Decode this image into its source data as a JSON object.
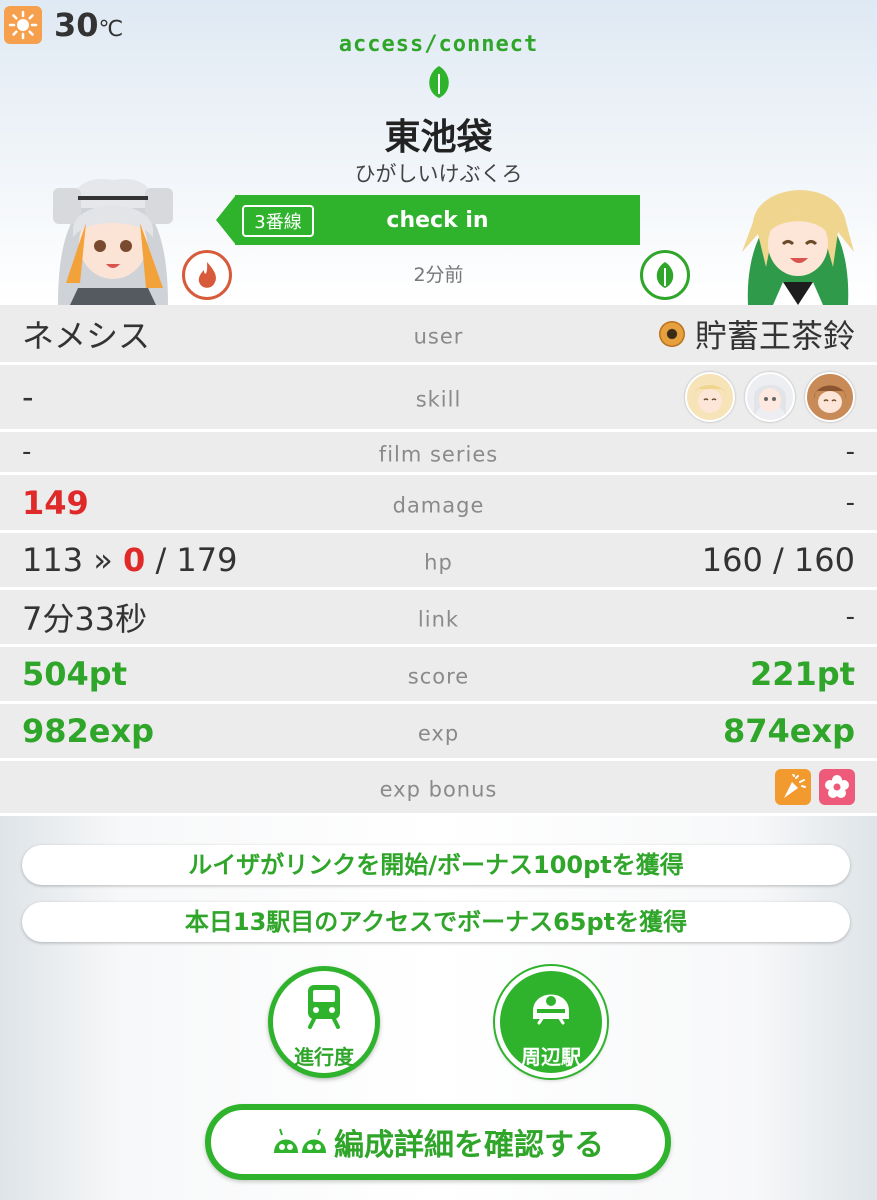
{
  "weather": {
    "icon": "sun-icon",
    "temp": "30",
    "unit": "℃"
  },
  "header": {
    "status": "access/connect",
    "station_name": "東池袋",
    "station_kana": "ひがしいけぶくろ",
    "line_label": "3番線",
    "action": "check in",
    "time_ago": "2分前"
  },
  "table": {
    "user": {
      "label": "user",
      "left": "ネメシス",
      "right": "貯蓄王茶鈴"
    },
    "skill": {
      "label": "skill",
      "left": "-"
    },
    "film_series": {
      "label": "film series",
      "left": "-",
      "right": "-"
    },
    "damage": {
      "label": "damage",
      "left": "149",
      "right": "-"
    },
    "hp": {
      "label": "hp",
      "left_before": "113 »",
      "left_now": "0",
      "left_max": "/ 179",
      "right": "160 / 160"
    },
    "link": {
      "label": "link",
      "left": "7分33秒",
      "right": "-"
    },
    "score": {
      "label": "score",
      "left": "504pt",
      "right": "221pt"
    },
    "exp": {
      "label": "exp",
      "left": "982exp",
      "right": "874exp"
    },
    "exp_bonus": {
      "label": "exp bonus"
    }
  },
  "messages": [
    "ルイザがリンクを開始/ボーナス100ptを獲得",
    "本日13駅目のアクセスでボーナス65ptを獲得"
  ],
  "buttons": {
    "progress": "進行度",
    "nearby": "周辺駅",
    "formation": "編成詳細を確認する"
  },
  "colors": {
    "accent": "#2fb32c",
    "damage": "#e02a2a",
    "fire": "#d75a3a"
  }
}
